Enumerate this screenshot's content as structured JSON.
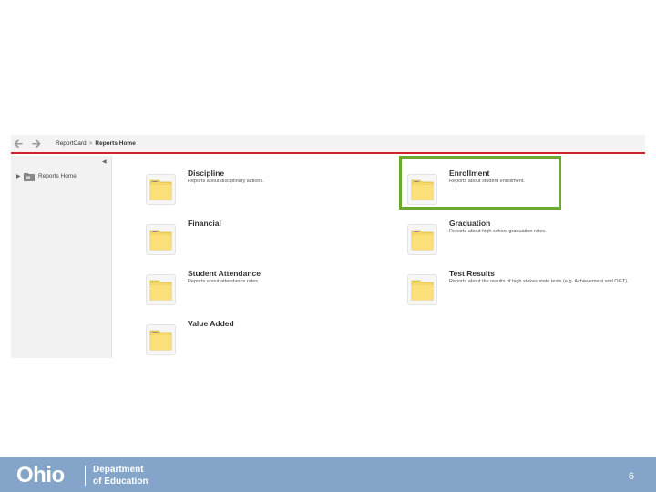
{
  "breadcrumb": {
    "root": "ReportCard",
    "separator": ">",
    "current": "Reports Home"
  },
  "sidebar": {
    "collapse_glyph": "◀",
    "items": [
      {
        "label": "Reports Home",
        "icon": "folder-icon"
      }
    ]
  },
  "tiles": [
    {
      "title": "Discipline",
      "description": "Reports about disciplinary actions."
    },
    {
      "title": "Enrollment",
      "description": "Reports about student enrollment."
    },
    {
      "title": "Financial",
      "description": ""
    },
    {
      "title": "Graduation",
      "description": "Reports about high school graduation rates."
    },
    {
      "title": "Student Attendance",
      "description": "Reports about attendance rates."
    },
    {
      "title": "Test Results",
      "description": "Reports about the results of high stakes state tests (e.g. Achievement and OGT)."
    },
    {
      "title": "Value Added",
      "description": ""
    }
  ],
  "highlighted_tile": "Enrollment",
  "footer": {
    "logo_text": "Ohio",
    "department_line1": "Department",
    "department_line2": "of Education",
    "page_number": "6"
  },
  "colors": {
    "accent_red": "#d2232a",
    "highlight_green": "#6aaa2f",
    "footer_blue": "#84a5c9",
    "folder_yellow": "#fbd960"
  }
}
